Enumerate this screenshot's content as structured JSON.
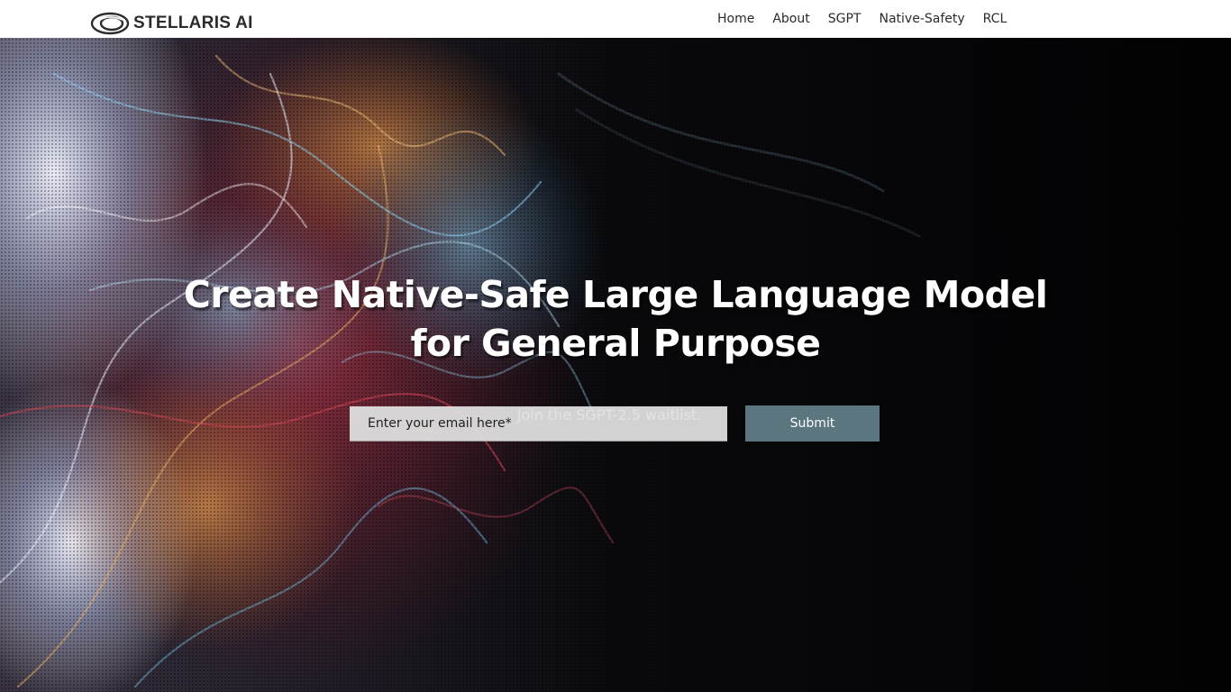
{
  "header": {
    "logo_text": "STELLARIS AI",
    "nav": [
      {
        "label": "Home"
      },
      {
        "label": "About"
      },
      {
        "label": "SGPT"
      },
      {
        "label": "Native-Safety"
      },
      {
        "label": "RCL"
      }
    ]
  },
  "hero": {
    "headline": "Create Native-Safe Large Language Model for General Purpose",
    "subheadline": "Join the SGPT-2.5 waitlist.",
    "email_placeholder": "Enter your email here*",
    "submit_label": "Submit",
    "background": "abstract-particle-waves"
  },
  "colors": {
    "header_bg": "#ffffff",
    "hero_bg": "#020203",
    "submit_bg": "#5c7680",
    "input_bg": "#e2e2e2",
    "text_on_hero": "#ffffff"
  }
}
